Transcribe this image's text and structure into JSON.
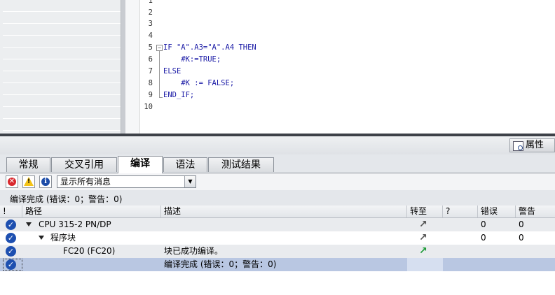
{
  "code_editor": {
    "line_numbers": [
      "1",
      "2",
      "3",
      "4",
      "5",
      "6",
      "7",
      "8",
      "9",
      "10"
    ],
    "lines": [
      "",
      "",
      "",
      "",
      "IF \"A\".A3=\"A\".A4 THEN",
      "    #K:=TRUE;",
      "ELSE",
      "    #K := FALSE;",
      "END_IF;",
      ""
    ]
  },
  "inspector": {
    "properties_label": "属性",
    "tabs": [
      {
        "label": "常规",
        "active": false
      },
      {
        "label": "交叉引用",
        "active": false
      },
      {
        "label": "编译",
        "active": true
      },
      {
        "label": "语法",
        "active": false
      },
      {
        "label": "测试结果",
        "active": false
      }
    ],
    "filter": {
      "value": "显示所有消息"
    },
    "summary": "编译完成 (错误：0；警告：0)",
    "columns": [
      "!",
      "路径",
      "描述",
      "转至",
      "?",
      "错误",
      "警告"
    ],
    "rows": [
      {
        "path": "CPU 315-2 PN/DP",
        "description": "",
        "errors": "0",
        "warnings": "0"
      },
      {
        "path": "程序块",
        "description": "",
        "errors": "0",
        "warnings": "0"
      },
      {
        "path": "FC20 (FC20)",
        "description": "块已成功编译。",
        "errors": "",
        "warnings": ""
      },
      {
        "path": "",
        "description": "编译完成 (错误：0；警告：0)",
        "errors": "",
        "warnings": ""
      }
    ]
  },
  "colors": {
    "accent": "#1d4fb0",
    "selection": "#b9c7e2",
    "goto_arrow": "#1a9a35",
    "keyword": "#1a1aa6"
  },
  "icons": [
    "error-filter-icon",
    "warning-filter-icon",
    "info-filter-icon",
    "check-circle-icon",
    "goto-arrow-icon",
    "properties-icon"
  ]
}
